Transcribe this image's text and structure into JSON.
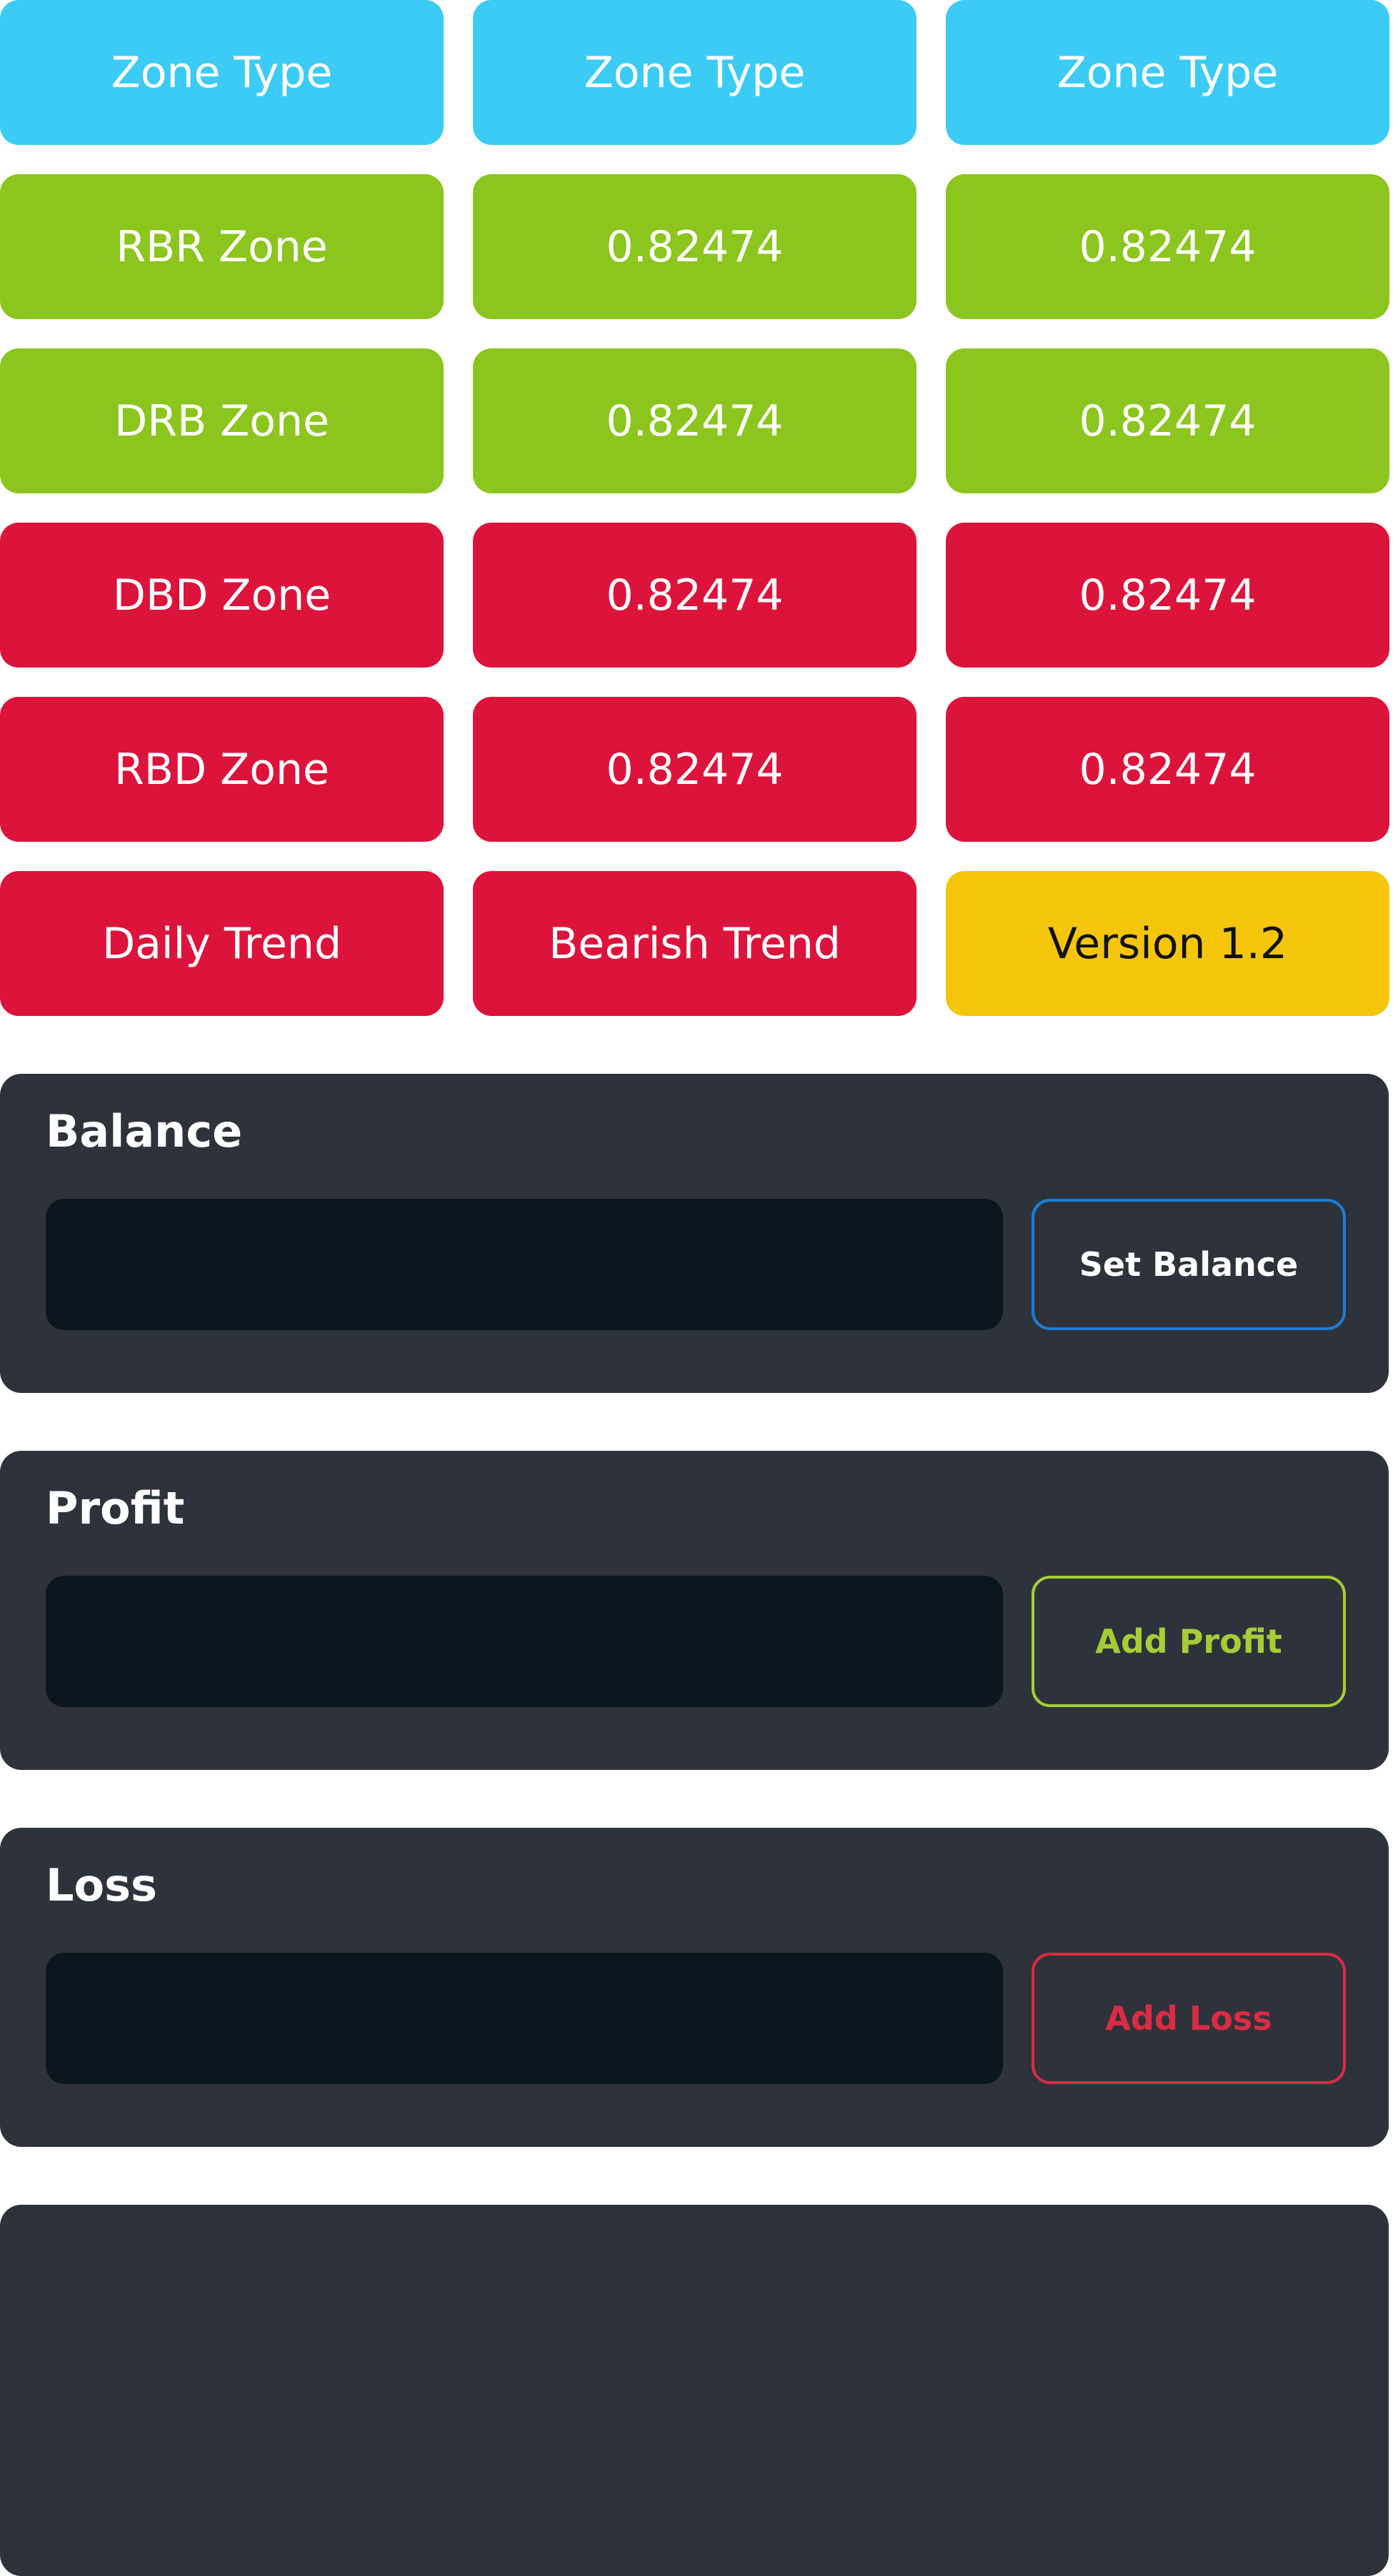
{
  "colors": {
    "header_tile": "#3ccbf4",
    "green_tile": "#8cc51e",
    "red_tile": "#dc143c",
    "yellow_tile": "#f5c50c",
    "panel_bg": "#2e333b",
    "input_bg": "#0b161e",
    "balance_accent": "#1b7fd6",
    "profit_accent": "#a6cd35",
    "loss_accent": "#dc2b42"
  },
  "zone_table": {
    "header": [
      "Zone Type",
      "Zone Type",
      "Zone Type"
    ],
    "rows": [
      [
        "RBR Zone",
        "0.82474",
        "0.82474"
      ],
      [
        "DRB Zone",
        "0.82474",
        "0.82474"
      ],
      [
        "DBD Zone",
        "0.82474",
        "0.82474"
      ],
      [
        "RBD Zone",
        "0.82474",
        "0.82474"
      ]
    ],
    "footer": {
      "daily_trend_label": "Daily Trend",
      "trend_value": "Bearish Trend",
      "version": "Version 1.2"
    }
  },
  "balance": {
    "title": "Balance",
    "input_value": "",
    "button_label": "Set Balance"
  },
  "profit": {
    "title": "Profit",
    "input_value": "",
    "button_label": "Add Profit"
  },
  "loss": {
    "title": "Loss",
    "input_value": "",
    "button_label": "Add Loss"
  }
}
